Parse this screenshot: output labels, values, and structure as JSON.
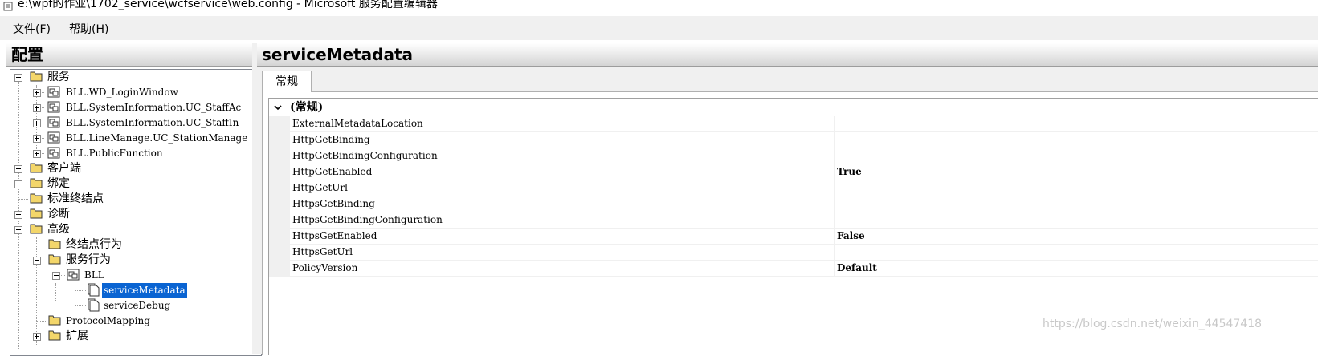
{
  "window": {
    "title": "e:\\wpf的作业\\1702_service\\wcfservice\\web.config - Microsoft 服务配置编辑器"
  },
  "menu": {
    "file": "文件(F)",
    "help": "帮助(H)"
  },
  "left_panel": {
    "header": "配置"
  },
  "tree": {
    "services": "服务",
    "svc1": "BLL.WD_LoginWindow",
    "svc2": "BLL.SystemInformation.UC_StaffAc",
    "svc3": "BLL.SystemInformation.UC_StaffIn",
    "svc4": "BLL.LineManage.UC_StationManage",
    "svc5": "BLL.PublicFunction",
    "client": "客户端",
    "bindings": "绑定",
    "std_endpoints": "标准终结点",
    "diagnostics": "诊断",
    "advanced": "高级",
    "endpoint_behaviors": "终结点行为",
    "service_behaviors": "服务行为",
    "bll": "BLL",
    "service_metadata": "serviceMetadata",
    "service_debug": "serviceDebug",
    "protocol_mapping": "ProtocolMapping",
    "extensions": "扩展"
  },
  "right_panel": {
    "header": "serviceMetadata",
    "tab": "常规"
  },
  "grid": {
    "category": "(常规)",
    "properties": [
      {
        "name": "ExternalMetadataLocation",
        "value": ""
      },
      {
        "name": "HttpGetBinding",
        "value": ""
      },
      {
        "name": "HttpGetBindingConfiguration",
        "value": ""
      },
      {
        "name": "HttpGetEnabled",
        "value": "True"
      },
      {
        "name": "HttpGetUrl",
        "value": ""
      },
      {
        "name": "HttpsGetBinding",
        "value": ""
      },
      {
        "name": "HttpsGetBindingConfiguration",
        "value": ""
      },
      {
        "name": "HttpsGetEnabled",
        "value": "False"
      },
      {
        "name": "HttpsGetUrl",
        "value": ""
      },
      {
        "name": "PolicyVersion",
        "value": "Default"
      }
    ]
  },
  "watermark": "https://blog.csdn.net/weixin_44547418",
  "icons": {
    "app": "config-editor-icon",
    "folder": "folder-icon",
    "service": "service-icon",
    "document": "document-icon",
    "expand": "expand-box-icon",
    "collapse": "collapse-box-icon",
    "chevron": "chevron-down-icon"
  },
  "colors": {
    "selection": "#0a64d2",
    "margin": "#f0f0f0"
  }
}
